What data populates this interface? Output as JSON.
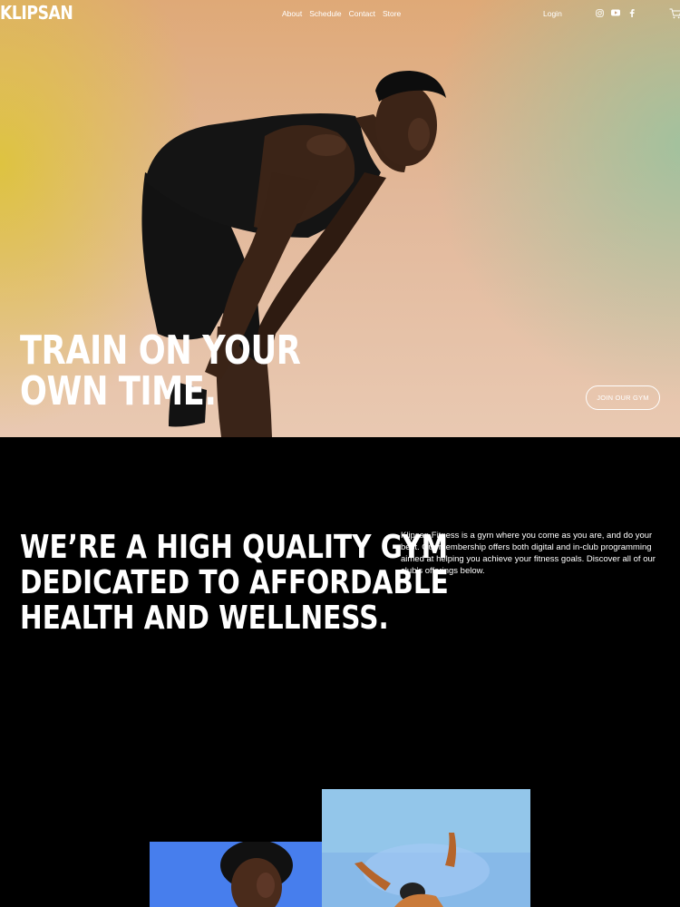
{
  "brand": {
    "logo": "KLIPSAN"
  },
  "nav": {
    "links": [
      "About",
      "Schedule",
      "Contact",
      "Store"
    ],
    "login": "Login",
    "social_icons": [
      "instagram-icon",
      "youtube-icon",
      "facebook-icon"
    ],
    "cart_icon": "cart-icon"
  },
  "hero": {
    "title": "TRAIN ON YOUR\nOWN TIME.",
    "cta_label": "JOIN OUR GYM"
  },
  "about": {
    "headline": "WE’RE A HIGH QUALITY GYM\nDEDICATED TO AFFORDABLE\nHEALTH AND WELLNESS.",
    "description": "Klipsan Fitness is a gym where you come as you are, and do your best. Our membership offers both digital and in-club programming aimed at helping you achieve your fitness goals. Discover all of our club’s offerings below."
  },
  "colors": {
    "background": "#000000",
    "text": "#ffffff",
    "hero_yellow": "#dec43c",
    "hero_peach": "#e2b89a",
    "hero_mint": "#96c4a0"
  }
}
